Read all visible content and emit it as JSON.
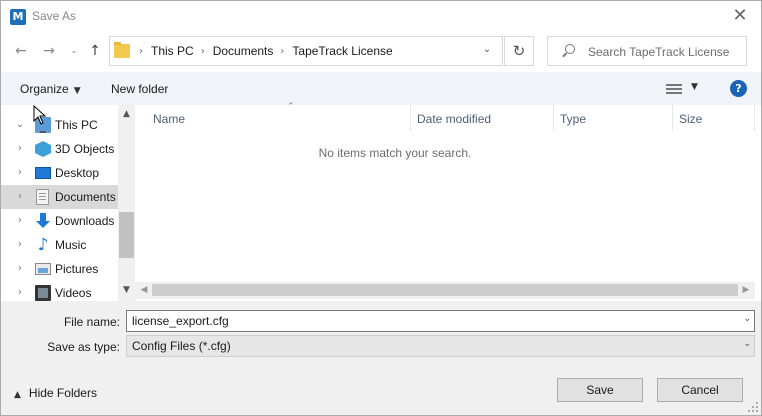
{
  "window": {
    "title": "Save As",
    "app_icon_letter": "M"
  },
  "nav": {
    "back_icon": "back-arrow-icon",
    "forward_icon": "forward-arrow-icon",
    "up_icon": "up-arrow-icon"
  },
  "address": {
    "crumbs": [
      "This PC",
      "Documents",
      "TapeTrack License"
    ]
  },
  "search": {
    "placeholder": "Search TapeTrack License"
  },
  "toolbar": {
    "organize_label": "Organize",
    "new_folder_label": "New folder",
    "help_label": "?"
  },
  "tree": {
    "items": [
      {
        "label": "This PC",
        "icon": "computer-icon",
        "expanded": true
      },
      {
        "label": "3D Objects",
        "icon": "cube-icon"
      },
      {
        "label": "Desktop",
        "icon": "desktop-icon"
      },
      {
        "label": "Documents",
        "icon": "documents-icon",
        "selected": true
      },
      {
        "label": "Downloads",
        "icon": "download-icon"
      },
      {
        "label": "Music",
        "icon": "music-note-icon"
      },
      {
        "label": "Pictures",
        "icon": "pictures-icon"
      },
      {
        "label": "Videos",
        "icon": "film-icon"
      }
    ]
  },
  "list": {
    "columns": [
      "Name",
      "Date modified",
      "Type",
      "Size"
    ],
    "empty_message": "No items match your search."
  },
  "form": {
    "filename_label": "File name:",
    "filename_value": "license_export.cfg",
    "savetype_label": "Save as type:",
    "savetype_value": "Config Files (*.cfg)"
  },
  "footer": {
    "hide_folders_label": "Hide Folders",
    "save_label": "Save",
    "cancel_label": "Cancel"
  },
  "colors": {
    "accent": "#1a64b8",
    "selection": "#d9d9d9",
    "command_bar": "#f0f4f9"
  }
}
